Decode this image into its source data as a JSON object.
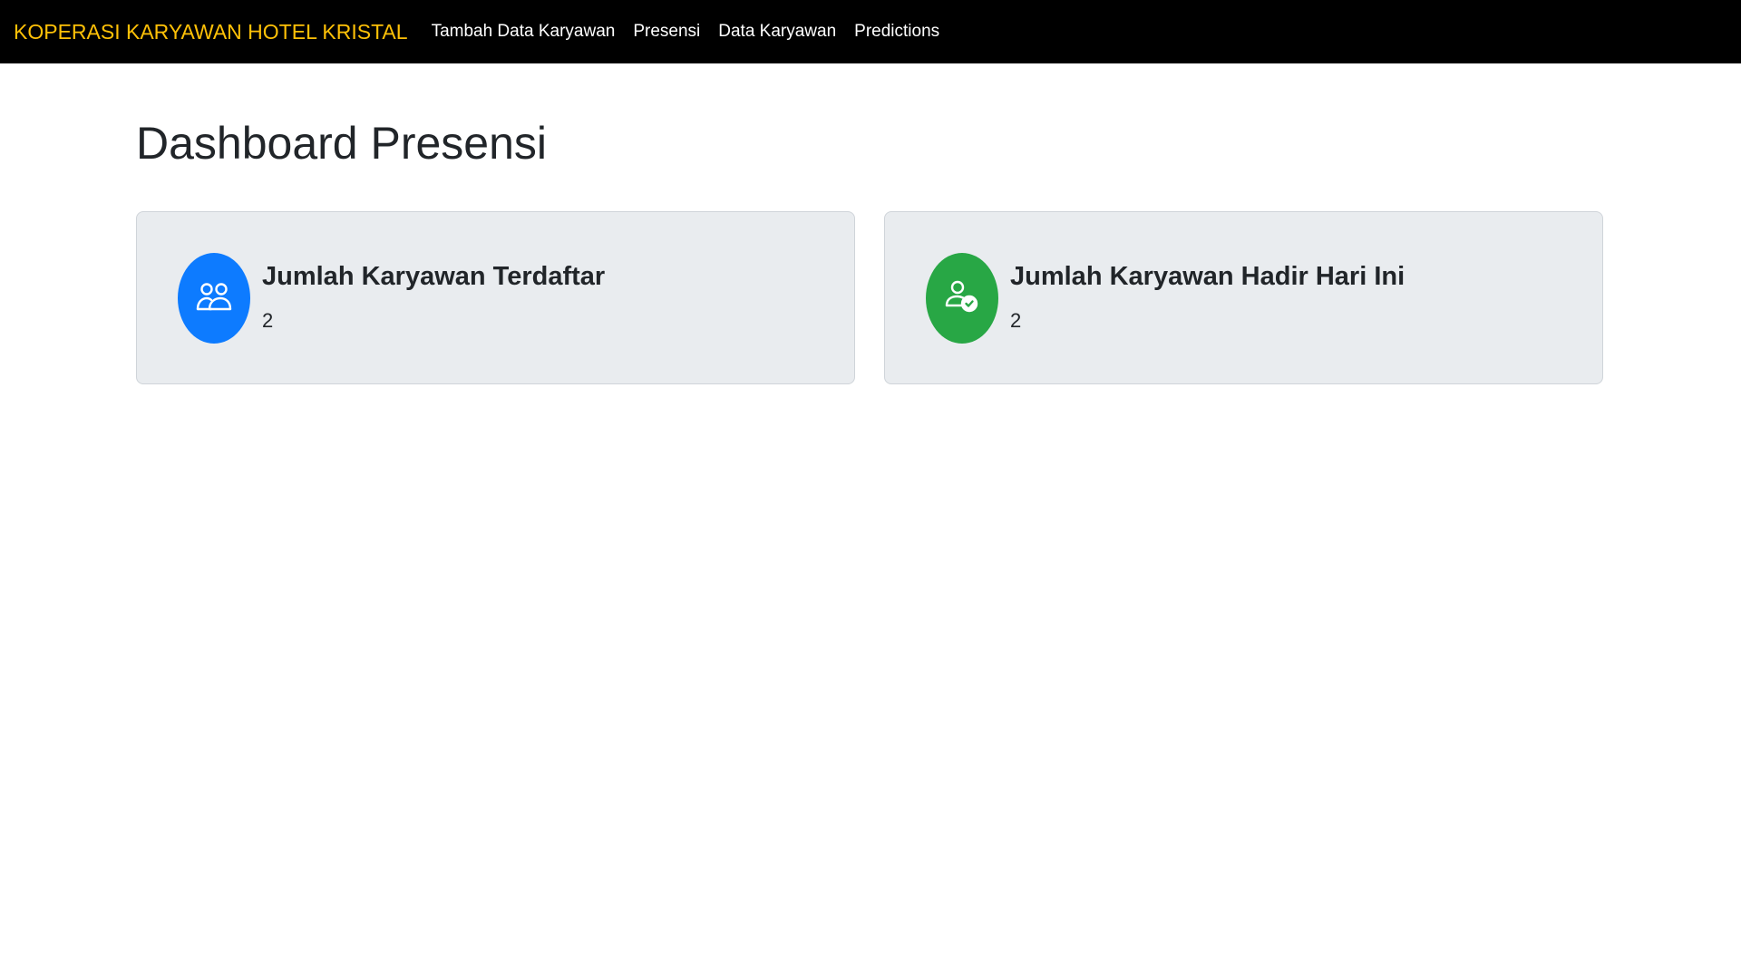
{
  "navbar": {
    "brand": "KOPERASI KARYAWAN HOTEL KRISTAL",
    "brand_color": "#ffc107",
    "links": [
      {
        "label": "Tambah Data Karyawan"
      },
      {
        "label": "Presensi"
      },
      {
        "label": "Data Karyawan"
      },
      {
        "label": "Predictions"
      }
    ]
  },
  "main": {
    "title": "Dashboard Presensi",
    "cards": [
      {
        "title": "Jumlah Karyawan Terdaftar",
        "value": "2",
        "icon": "people-icon",
        "color": "#0d7bff"
      },
      {
        "title": "Jumlah Karyawan Hadir Hari Ini",
        "value": "2",
        "icon": "person-check-icon",
        "color": "#28a745"
      }
    ]
  }
}
